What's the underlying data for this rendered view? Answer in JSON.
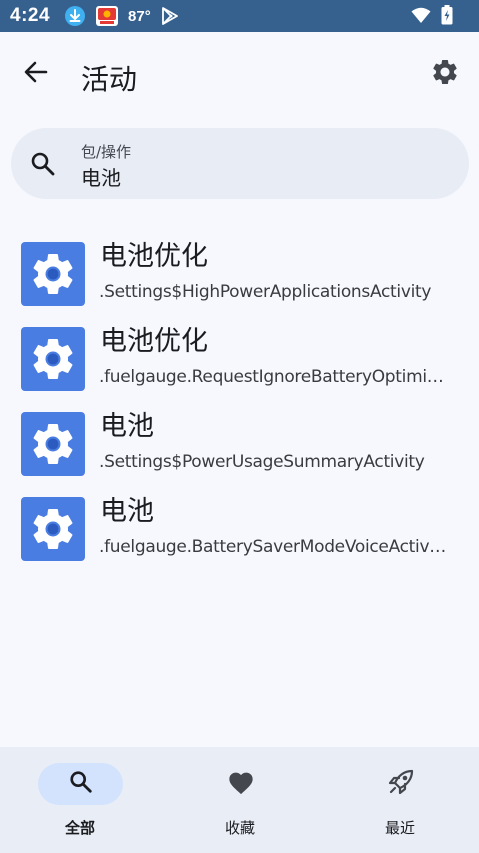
{
  "status_bar": {
    "time": "4:24",
    "temperature": "87°",
    "background": "#36618f",
    "icons": [
      "download-icon",
      "app-notification-icon",
      "play-store-icon",
      "wifi-icon",
      "battery-icon"
    ]
  },
  "app_bar": {
    "title": "活动",
    "back_icon": "arrow-back-icon",
    "settings_icon": "gear-icon"
  },
  "search": {
    "label": "包/操作",
    "value": "电池",
    "icon": "search-icon"
  },
  "results": [
    {
      "title": "电池优化",
      "subtitle": ".Settings$HighPowerApplicationsActivity"
    },
    {
      "title": "电池优化",
      "subtitle": ".fuelgauge.RequestIgnoreBatteryOptimi…"
    },
    {
      "title": "电池",
      "subtitle": ".Settings$PowerUsageSummaryActivity"
    },
    {
      "title": "电池",
      "subtitle": ".fuelgauge.BatterySaverModeVoiceActiv…"
    }
  ],
  "bottom_nav": {
    "items": [
      {
        "label": "全部",
        "icon": "search-icon",
        "active": true
      },
      {
        "label": "收藏",
        "icon": "heart-icon",
        "active": false
      },
      {
        "label": "最近",
        "icon": "rocket-icon",
        "active": false
      }
    ]
  },
  "colors": {
    "background": "#f6f8fe",
    "accent_pill": "#d3e3fd",
    "icon_blue": "#4a7de1",
    "nav_background": "#e9edf5"
  }
}
